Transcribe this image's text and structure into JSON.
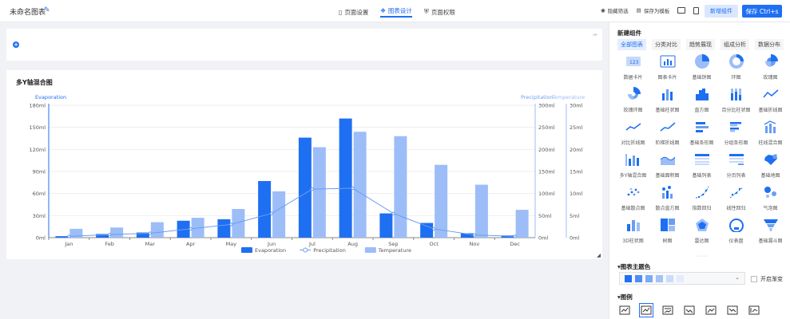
{
  "app": {
    "title": "未命名图表"
  },
  "header": {
    "tabs": [
      {
        "label": "页面设置",
        "icon": "bookmark-icon",
        "active": false
      },
      {
        "label": "图表设计",
        "icon": "chart-design-icon",
        "active": true
      },
      {
        "label": "页面权限",
        "icon": "shield-icon",
        "active": false
      }
    ],
    "actions": [
      {
        "label": "隐藏筛选",
        "icon": "eye-icon"
      },
      {
        "label": "保存为模板",
        "icon": "template-icon"
      }
    ],
    "add_label": "新增组件",
    "save_label": "保存 Ctrl+s"
  },
  "chart": {
    "title": "多Y轴混合图",
    "left_axis_name": "Evaporation",
    "right_axis_names": [
      "Precipitation",
      "Temperature"
    ],
    "legend": [
      "Evaporation",
      "Precipitation",
      "Temperature"
    ]
  },
  "chart_data": {
    "type": "bar",
    "title": "多Y轴混合图",
    "categories": [
      "Jan",
      "Feb",
      "Mar",
      "Apr",
      "May",
      "Jun",
      "Jul",
      "Aug",
      "Sep",
      "Oct",
      "Nov",
      "Dec"
    ],
    "y_axes": [
      {
        "name": "Evaporation",
        "ticks": [
          "0ml",
          "30ml",
          "60ml",
          "90ml",
          "120ml",
          "150ml",
          "180ml"
        ],
        "range": [
          0,
          180
        ]
      },
      {
        "name": "Precipitation",
        "ticks": [
          "0ml",
          "50ml",
          "100ml",
          "150ml",
          "200ml",
          "250ml",
          "300ml"
        ],
        "range": [
          0,
          300
        ]
      },
      {
        "name": "Temperature",
        "ticks": [
          "0ml",
          "5ml",
          "10ml",
          "15ml",
          "20ml",
          "25ml",
          "30ml"
        ],
        "range": [
          0,
          30
        ]
      }
    ],
    "series": [
      {
        "name": "Evaporation",
        "kind": "bar",
        "axis": 0,
        "color": "#1f6ff2",
        "values": [
          2,
          5,
          7,
          23,
          25,
          77,
          136,
          162,
          33,
          20,
          6,
          3
        ]
      },
      {
        "name": "Precipitation",
        "kind": "line",
        "axis": 1,
        "color": "#6a9ef0",
        "values": [
          3,
          7,
          10,
          20,
          30,
          55,
          110,
          112,
          55,
          20,
          6,
          3
        ]
      },
      {
        "name": "Temperature",
        "kind": "bar",
        "axis": 2,
        "color": "#9cbdf7",
        "values": [
          2,
          2.3,
          3.5,
          4.5,
          6.5,
          10.5,
          20.5,
          24,
          23,
          16.5,
          12,
          6.3
        ]
      }
    ]
  },
  "panel": {
    "title": "新建组件",
    "categories": [
      {
        "label": "全部图表",
        "active": true
      },
      {
        "label": "分类对比",
        "active": false
      },
      {
        "label": "趋势展现",
        "active": false
      },
      {
        "label": "组成分析",
        "active": false
      },
      {
        "label": "数据分布",
        "active": false
      }
    ],
    "widgets": [
      {
        "label": "数据卡片",
        "icon": "data-card-icon"
      },
      {
        "label": "图表卡片",
        "icon": "chart-card-icon"
      },
      {
        "label": "基础饼图",
        "icon": "pie-chart-icon"
      },
      {
        "label": "环图",
        "icon": "donut-chart-icon"
      },
      {
        "label": "玫瑰图",
        "icon": "rose-chart-icon"
      },
      {
        "label": "玫瑰环图",
        "icon": "rose-ring-icon"
      },
      {
        "label": "基础柱状图",
        "icon": "bar-chart-icon"
      },
      {
        "label": "直方图",
        "icon": "histogram-icon"
      },
      {
        "label": "百分比柱状图",
        "icon": "percent-bar-icon"
      },
      {
        "label": "基础折线图",
        "icon": "line-chart-icon"
      },
      {
        "label": "对比折线图",
        "icon": "compare-line-icon"
      },
      {
        "label": "阶梯折线图",
        "icon": "step-line-icon"
      },
      {
        "label": "基础条形图",
        "icon": "horizontal-bar-icon"
      },
      {
        "label": "分组条形图",
        "icon": "grouped-bar-icon"
      },
      {
        "label": "柱线混合图",
        "icon": "bar-line-combo-icon"
      },
      {
        "label": "多Y轴混合图",
        "icon": "multi-axis-icon"
      },
      {
        "label": "基础面积图",
        "icon": "area-chart-icon"
      },
      {
        "label": "基础列表",
        "icon": "list-icon"
      },
      {
        "label": "分页列表",
        "icon": "paged-list-icon"
      },
      {
        "label": "基础地图",
        "icon": "map-icon"
      },
      {
        "label": "基础散点图",
        "icon": "scatter-icon"
      },
      {
        "label": "散点直方图",
        "icon": "scatter-histogram-icon"
      },
      {
        "label": "指数回归",
        "icon": "exp-regression-icon"
      },
      {
        "label": "线性回归",
        "icon": "linear-regression-icon"
      },
      {
        "label": "气泡图",
        "icon": "bubble-chart-icon"
      },
      {
        "label": "3D柱状图",
        "icon": "bar-3d-icon"
      },
      {
        "label": "树图",
        "icon": "tree-map-icon"
      },
      {
        "label": "雷达图",
        "icon": "radar-chart-icon"
      },
      {
        "label": "仪表盘",
        "icon": "gauge-icon"
      },
      {
        "label": "基础漏斗图",
        "icon": "funnel-icon"
      }
    ],
    "theme_section": "图表主题色",
    "theme_colors": [
      "#1f6ff2",
      "#4d8ef5",
      "#7aabf7",
      "#a3c3f9",
      "#c9dcfb",
      "#e2ecfd"
    ],
    "gradient_label": "开启渐变",
    "legend_section": "图例"
  }
}
